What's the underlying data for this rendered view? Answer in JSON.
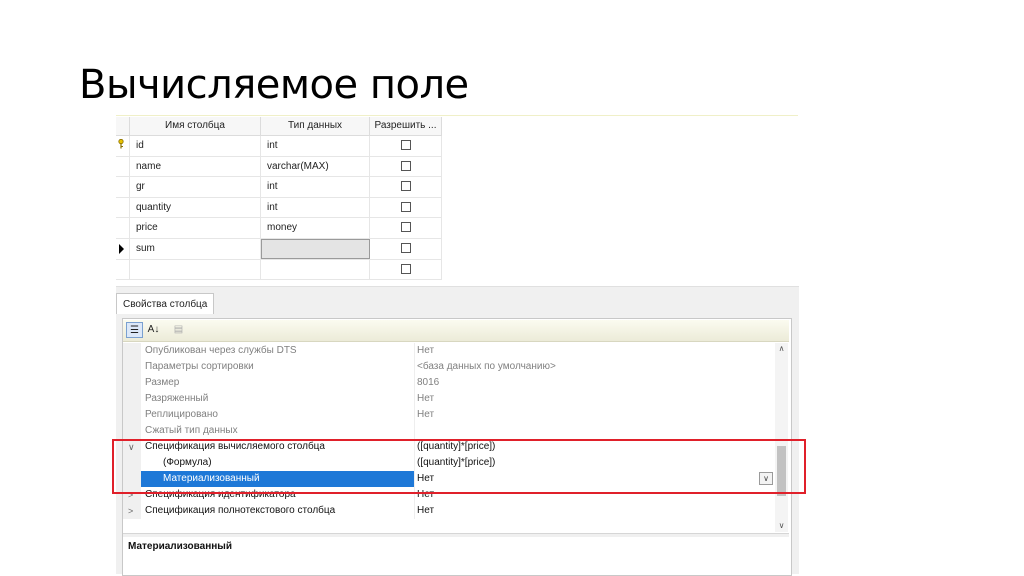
{
  "slide": {
    "title": "Вычисляемое поле"
  },
  "grid": {
    "headers": [
      "Имя столбца",
      "Тип данных",
      "Разрешить ..."
    ],
    "rows": [
      {
        "name": "id",
        "type": "int",
        "key": true
      },
      {
        "name": "name",
        "type": "varchar(MAX)"
      },
      {
        "name": "gr",
        "type": "int"
      },
      {
        "name": "quantity",
        "type": "int"
      },
      {
        "name": "price",
        "type": "money"
      },
      {
        "name": "sum",
        "type": "",
        "current": true
      },
      {
        "name": "",
        "type": ""
      }
    ]
  },
  "properties": {
    "tab_label": "Свойства столбца",
    "toolbar": {
      "categorized": "☰",
      "alphabetical": "A↓",
      "pages": "▤"
    },
    "rows": [
      {
        "name": "Опубликован через службы DTS",
        "value": "Нет"
      },
      {
        "name": "Параметры сортировки",
        "value": "<база данных по умолчанию>"
      },
      {
        "name": "Размер",
        "value": "8016"
      },
      {
        "name": "Разряженный",
        "value": "Нет"
      },
      {
        "name": "Реплицировано",
        "value": "Нет"
      },
      {
        "name": "Сжатый тип данных",
        "value": ""
      },
      {
        "name": "Спецификация вычисляемого столбца",
        "value": "([quantity]*[price])",
        "toggle": "∨"
      },
      {
        "name": "(Формула)",
        "value": "([quantity]*[price])"
      },
      {
        "name": "Материализованный",
        "value": "Нет"
      },
      {
        "name": "Спецификация идентификатора",
        "value": "Нет",
        "toggle": ">"
      },
      {
        "name": "Спецификация полнотекстового столбца",
        "value": "Нет",
        "toggle": ">"
      }
    ],
    "description_title": "Материализованный"
  },
  "colors": {
    "highlight": "#e0202a",
    "selection": "#1e78d7"
  }
}
